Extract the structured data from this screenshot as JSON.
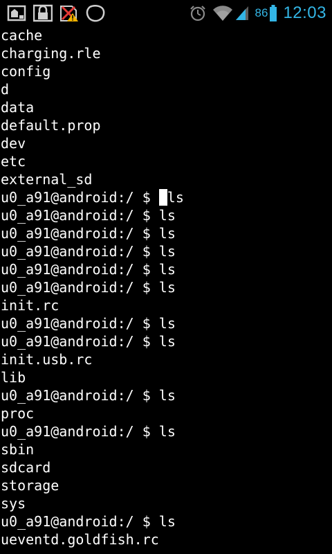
{
  "status_bar": {
    "left_icons": [
      "screenshot-icon",
      "lock-icon",
      "no-sim-warning-icon",
      "blob-icon"
    ],
    "right_icons": [
      "alarm-icon",
      "wifi-icon",
      "signal-icon",
      "battery-icon"
    ],
    "battery_percent": "86",
    "clock": "12:03",
    "accent_color": "#33b5e5"
  },
  "terminal": {
    "prompt": "u0_a91@android:/ $ ",
    "cursor_line_index": 9,
    "lines": [
      "cache",
      "charging.rle",
      "config",
      "d",
      "data",
      "default.prop",
      "dev",
      "etc",
      "external_sd",
      "u0_a91@android:/ $ ls",
      "u0_a91@android:/ $ ls",
      "u0_a91@android:/ $ ls",
      "u0_a91@android:/ $ ls",
      "u0_a91@android:/ $ ls",
      "u0_a91@android:/ $ ls",
      "init.rc",
      "u0_a91@android:/ $ ls",
      "u0_a91@android:/ $ ls",
      "init.usb.rc",
      "lib",
      "u0_a91@android:/ $ ls",
      "proc",
      "u0_a91@android:/ $ ls",
      "sbin",
      "sdcard",
      "storage",
      "sys",
      "u0_a91@android:/ $ ls",
      "ueventd.goldfish.rc"
    ],
    "cursor_line": {
      "before": "u0_a91@android:/ $ ",
      "cursor_char": " ",
      "after": "ls"
    }
  }
}
